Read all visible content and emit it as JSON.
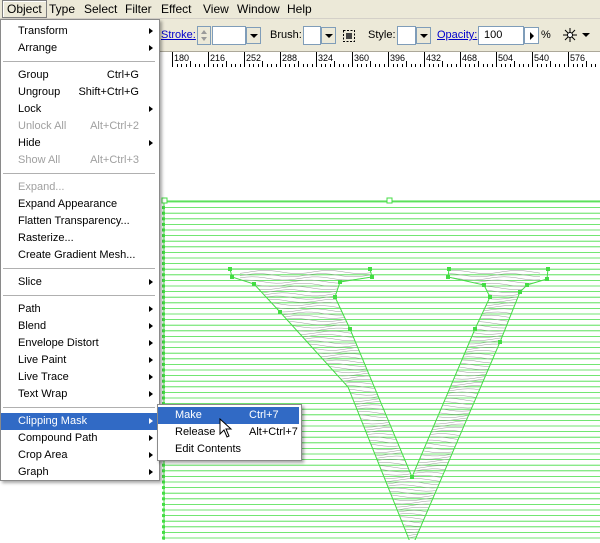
{
  "menubar": {
    "items": [
      "Object",
      "Type",
      "Select",
      "Filter",
      "Effect",
      "View",
      "Window",
      "Help"
    ],
    "active": "Object"
  },
  "controlbar": {
    "stroke_label": "Stroke:",
    "brush_label": "Brush:",
    "style_label": "Style:",
    "opacity_label": "Opacity:",
    "opacity_value": "100",
    "opacity_unit": "%"
  },
  "ruler": {
    "labels": [
      "180",
      "216",
      "252",
      "288",
      "324",
      "360",
      "396",
      "432",
      "468",
      "504",
      "540",
      "576"
    ]
  },
  "object_menu": {
    "groups": [
      [
        {
          "label": "Transform",
          "submenu": true
        },
        {
          "label": "Arrange",
          "submenu": true
        }
      ],
      [
        {
          "label": "Group",
          "shortcut": "Ctrl+G"
        },
        {
          "label": "Ungroup",
          "shortcut": "Shift+Ctrl+G"
        },
        {
          "label": "Lock",
          "submenu": true
        },
        {
          "label": "Unlock All",
          "shortcut": "Alt+Ctrl+2",
          "disabled": true
        },
        {
          "label": "Hide",
          "submenu": true
        },
        {
          "label": "Show All",
          "shortcut": "Alt+Ctrl+3",
          "disabled": true
        }
      ],
      [
        {
          "label": "Expand...",
          "disabled": true
        },
        {
          "label": "Expand Appearance"
        },
        {
          "label": "Flatten Transparency..."
        },
        {
          "label": "Rasterize..."
        },
        {
          "label": "Create Gradient Mesh..."
        }
      ],
      [
        {
          "label": "Slice",
          "submenu": true
        }
      ],
      [
        {
          "label": "Path",
          "submenu": true
        },
        {
          "label": "Blend",
          "submenu": true
        },
        {
          "label": "Envelope Distort",
          "submenu": true
        },
        {
          "label": "Live Paint",
          "submenu": true
        },
        {
          "label": "Live Trace",
          "submenu": true
        },
        {
          "label": "Text Wrap",
          "submenu": true
        }
      ],
      [
        {
          "label": "Clipping Mask",
          "submenu": true,
          "highlighted": true
        },
        {
          "label": "Compound Path",
          "submenu": true
        },
        {
          "label": "Crop Area",
          "submenu": true
        },
        {
          "label": "Graph",
          "submenu": true
        }
      ]
    ]
  },
  "clipping_submenu": {
    "items": [
      {
        "label": "Make",
        "shortcut": "Ctrl+7",
        "highlighted": true
      },
      {
        "label": "Release",
        "shortcut": "Alt+Ctrl+7"
      },
      {
        "label": "Edit Contents",
        "shortcut": ""
      }
    ]
  },
  "colors": {
    "selection_green": "#44dd44",
    "menu_highlight": "#316ac5",
    "menubar_bg": "#ece9d8",
    "link_blue": "#0000cc"
  },
  "icons": {
    "brush_options": "dotted-square-icon",
    "cursor": "arrow-cursor-icon",
    "control_options": "star-options-icon"
  }
}
